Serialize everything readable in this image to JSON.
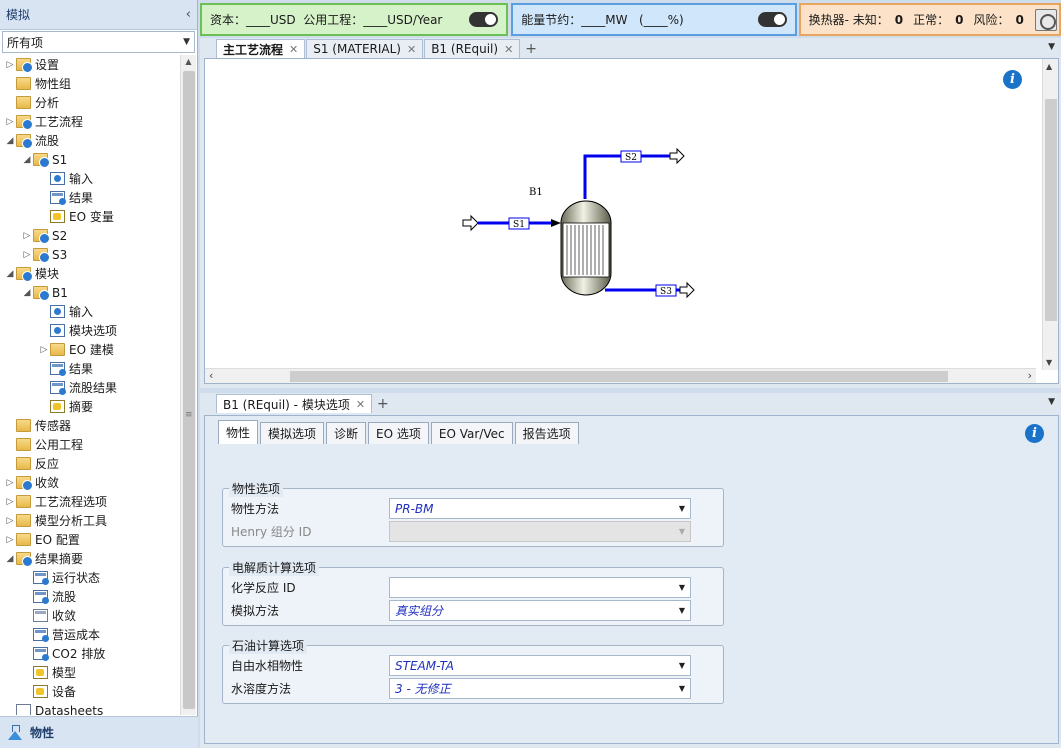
{
  "nav": {
    "title": "模拟",
    "collapse": "‹",
    "filter": "所有项",
    "items": [
      {
        "label": "设置",
        "indent": 0,
        "expander": "▷",
        "icon": "folder-ok"
      },
      {
        "label": "物性组",
        "indent": 0,
        "expander": "",
        "icon": "folder"
      },
      {
        "label": "分析",
        "indent": 0,
        "expander": "",
        "icon": "folder"
      },
      {
        "label": "工艺流程",
        "indent": 0,
        "expander": "▷",
        "icon": "folder-ok"
      },
      {
        "label": "流股",
        "indent": 0,
        "expander": "◢",
        "icon": "folder-ok"
      },
      {
        "label": "S1",
        "indent": 1,
        "expander": "◢",
        "icon": "folder-ok"
      },
      {
        "label": "输入",
        "indent": 2,
        "expander": "",
        "icon": "form-ok"
      },
      {
        "label": "结果",
        "indent": 2,
        "expander": "",
        "icon": "form-res"
      },
      {
        "label": "EO 变量",
        "indent": 2,
        "expander": "",
        "icon": "form-eo"
      },
      {
        "label": "S2",
        "indent": 1,
        "expander": "▷",
        "icon": "folder-ok"
      },
      {
        "label": "S3",
        "indent": 1,
        "expander": "▷",
        "icon": "folder-ok"
      },
      {
        "label": "模块",
        "indent": 0,
        "expander": "◢",
        "icon": "folder-ok"
      },
      {
        "label": "B1",
        "indent": 1,
        "expander": "◢",
        "icon": "folder-ok"
      },
      {
        "label": "输入",
        "indent": 2,
        "expander": "",
        "icon": "form-ok"
      },
      {
        "label": "模块选项",
        "indent": 2,
        "expander": "",
        "icon": "form-ok"
      },
      {
        "label": "EO 建模",
        "indent": 2,
        "expander": "▷",
        "icon": "folder"
      },
      {
        "label": "结果",
        "indent": 2,
        "expander": "",
        "icon": "form-res"
      },
      {
        "label": "流股结果",
        "indent": 2,
        "expander": "",
        "icon": "form-res"
      },
      {
        "label": "摘要",
        "indent": 2,
        "expander": "",
        "icon": "form-eo"
      },
      {
        "label": "传感器",
        "indent": 0,
        "expander": "",
        "icon": "folder"
      },
      {
        "label": "公用工程",
        "indent": 0,
        "expander": "",
        "icon": "folder"
      },
      {
        "label": "反应",
        "indent": 0,
        "expander": "",
        "icon": "folder"
      },
      {
        "label": "收敛",
        "indent": 0,
        "expander": "▷",
        "icon": "folder-ok"
      },
      {
        "label": "工艺流程选项",
        "indent": 0,
        "expander": "▷",
        "icon": "folder"
      },
      {
        "label": "模型分析工具",
        "indent": 0,
        "expander": "▷",
        "icon": "folder"
      },
      {
        "label": "EO 配置",
        "indent": 0,
        "expander": "▷",
        "icon": "folder"
      },
      {
        "label": "结果摘要",
        "indent": 0,
        "expander": "◢",
        "icon": "folder-ok"
      },
      {
        "label": "运行状态",
        "indent": 1,
        "expander": "",
        "icon": "form-res"
      },
      {
        "label": "流股",
        "indent": 1,
        "expander": "",
        "icon": "form-res"
      },
      {
        "label": "收敛",
        "indent": 1,
        "expander": "",
        "icon": "form-plain"
      },
      {
        "label": "营运成本",
        "indent": 1,
        "expander": "",
        "icon": "form-res"
      },
      {
        "label": "CO2 排放",
        "indent": 1,
        "expander": "",
        "icon": "form-res"
      },
      {
        "label": "模型",
        "indent": 1,
        "expander": "",
        "icon": "form-eo"
      },
      {
        "label": "设备",
        "indent": 1,
        "expander": "",
        "icon": "form-eo"
      },
      {
        "label": "Datasheets",
        "indent": 0,
        "expander": "",
        "icon": "datasheet"
      }
    ],
    "footer": "物性"
  },
  "topbar": {
    "cost_text": "资本：____USD  公用工程：____USD/Year",
    "energy_text": "能量节约：____MW   (____%)",
    "hx_label": "换热器- 未知：",
    "hx_unknown": "0",
    "hx_normal_label": "正常：",
    "hx_normal": "0",
    "hx_risk_label": "风险：",
    "hx_risk": "0"
  },
  "doc_tabs": [
    {
      "label": "主工艺流程",
      "active": true
    },
    {
      "label": "S1 (MATERIAL)",
      "active": false
    },
    {
      "label": "B1 (REquil)",
      "active": false
    }
  ],
  "flowsheet": {
    "block_label": "B1",
    "streams": [
      "S1",
      "S2",
      "S3"
    ]
  },
  "form": {
    "tab": "B1 (REquil) - 模块选项",
    "subtabs": [
      "物性",
      "模拟选项",
      "诊断",
      "EO 选项",
      "EO Var/Vec",
      "报告选项"
    ],
    "groups": [
      {
        "title": "物性选项",
        "rows": [
          {
            "label": "物性方法",
            "value": "PR-BM",
            "disabled": false
          },
          {
            "label": "Henry 组分 ID",
            "value": "",
            "disabled": true
          }
        ]
      },
      {
        "title": "电解质计算选项",
        "rows": [
          {
            "label": "化学反应 ID",
            "value": "",
            "disabled": false
          },
          {
            "label": "模拟方法",
            "value": "真实组分",
            "disabled": false
          }
        ]
      },
      {
        "title": "石油计算选项",
        "rows": [
          {
            "label": "自由水相物性",
            "value": "STEAM-TA",
            "disabled": false
          },
          {
            "label": "水溶度方法",
            "value": "3 - 无修正",
            "disabled": false
          }
        ]
      }
    ]
  },
  "colors": {
    "stream": "#0000ee",
    "accent": "#1a73c9"
  }
}
